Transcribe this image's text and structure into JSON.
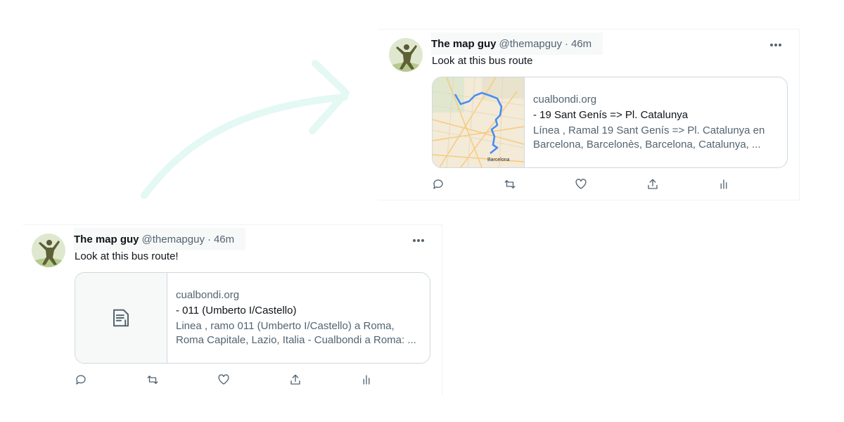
{
  "tweets": [
    {
      "author_name": "The map guy",
      "handle": "@themapguy",
      "separator": "·",
      "time": "46m",
      "text": "Look at this bus route",
      "card": {
        "thumbnail": "map-thumbnail",
        "domain": "cualbondi.org",
        "title": "- 19 Sant Genís => Pl. Catalunya",
        "description_line1": "Línea , Ramal 19 Sant Genís => Pl. Catalunya en",
        "description_line2": "Barcelona, Barcelonès, Barcelona, Catalunya, ...",
        "map_label": "Barcelona"
      }
    },
    {
      "author_name": "The map guy",
      "handle": "@themapguy",
      "separator": "·",
      "time": "46m",
      "text": "Look at this bus route!",
      "card": {
        "thumbnail": "document-icon",
        "domain": "cualbondi.org",
        "title": "- 011 (Umberto I/Castello)",
        "description_line1": "Linea , ramo 011 (Umberto I/Castello) a Roma,",
        "description_line2": "Roma Capitale, Lazio, Italia - Cualbondi a Roma: ..."
      }
    }
  ],
  "actions": [
    "reply-icon",
    "retweet-icon",
    "like-icon",
    "share-icon",
    "analytics-icon"
  ],
  "colors": {
    "text": "#0f1419",
    "secondary": "#536471",
    "border": "#cfd9de",
    "route": "#4a8ef5",
    "arrow": "#d6f5f0"
  }
}
